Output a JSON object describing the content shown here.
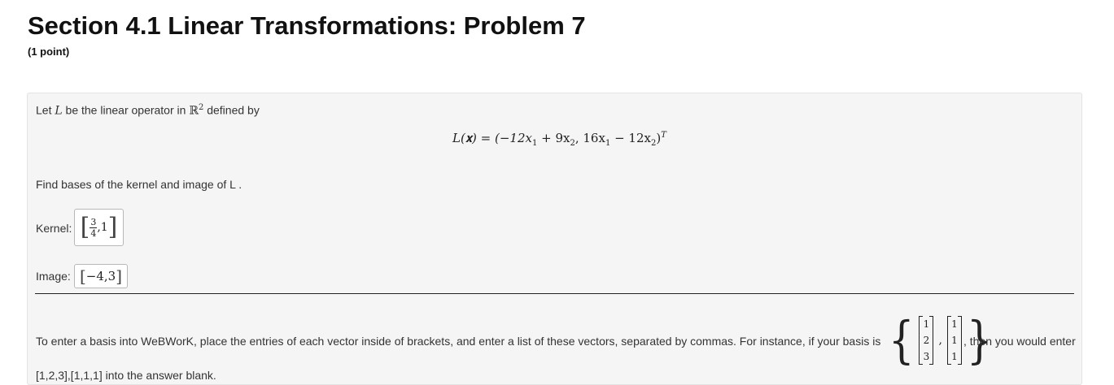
{
  "header": {
    "title": "Section 4.1 Linear Transformations: Problem 7",
    "points": "(1 point)"
  },
  "problem": {
    "intro_prefix": "Let ",
    "intro_var": "L",
    "intro_middle": " be the linear operator in ",
    "intro_space": "ℝ",
    "intro_space_exp": "2",
    "intro_suffix": " defined by",
    "equation_lhs": "L(𝐱) = (−12x",
    "equation_sub1": "1",
    "equation_mid1": " + 9x",
    "equation_sub2": "2",
    "equation_mid2": ", 16x",
    "equation_sub3": "1",
    "equation_mid3": " − 12x",
    "equation_sub4": "2",
    "equation_close": ")",
    "equation_sup": "T",
    "find_text": "Find bases of the kernel and image of L ."
  },
  "kernel": {
    "label": "Kernel:",
    "frac_num": "3",
    "frac_den": "4",
    "rest": ",1",
    "bracket_open": "[",
    "bracket_close": "]"
  },
  "image": {
    "label": "Image:",
    "value": "−4,3",
    "bracket_open": "[",
    "bracket_close": "]"
  },
  "instructions": {
    "text": "To enter a basis into WeBWorK, place the entries of each vector inside of brackets, and enter a list of these vectors, separated by commas. For instance, if your basis is",
    "suffix": ", then you would enter",
    "example_vectors": [
      [
        "1",
        "2",
        "3"
      ],
      [
        "1",
        "1",
        "1"
      ]
    ],
    "example_answer": "[1,2,3],[1,1,1] into the answer blank."
  }
}
